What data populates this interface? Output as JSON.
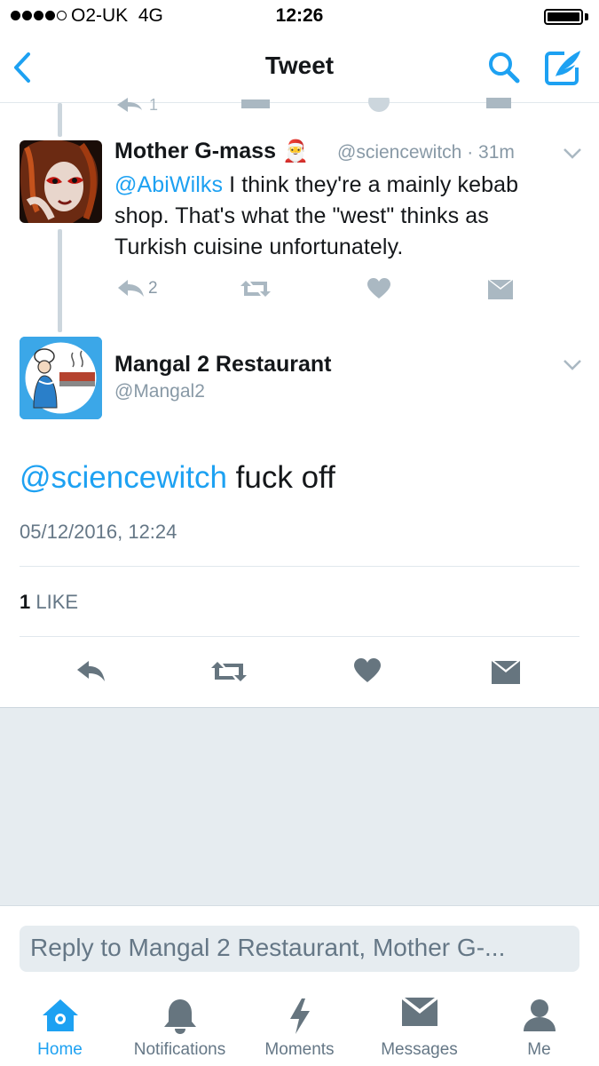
{
  "status_bar": {
    "carrier": "O2-UK",
    "network": "4G",
    "time": "12:26"
  },
  "nav": {
    "title": "Tweet"
  },
  "parent_tweet": {
    "author_name": "Mother G-mass",
    "author_emoji": "🎅",
    "handle": "@sciencewitch",
    "time_ago": "31m",
    "mention": "@AbiWilks",
    "text_line1": " I think they're a mainly kebab",
    "text_line2": "shop. That's what the \"west\" thinks as",
    "text_line3": "Turkish cuisine unfortunately.",
    "reply_count": "2"
  },
  "main_tweet": {
    "author_name": "Mangal 2 Restaurant",
    "handle": "@Mangal2",
    "mention": "@sciencewitch",
    "text": " fuck off",
    "timestamp": "05/12/2016, 12:24",
    "like_count": "1",
    "like_label": "LIKE"
  },
  "reply_box": {
    "placeholder": "Reply to Mangal 2 Restaurant, Mother G-..."
  },
  "tabs": [
    {
      "label": "Home",
      "icon": "home-icon",
      "active": true
    },
    {
      "label": "Notifications",
      "icon": "bell-icon",
      "active": false
    },
    {
      "label": "Moments",
      "icon": "lightning-icon",
      "active": false
    },
    {
      "label": "Messages",
      "icon": "envelope-icon",
      "active": false
    },
    {
      "label": "Me",
      "icon": "person-icon",
      "active": false
    }
  ],
  "colors": {
    "accent": "#1da1f2",
    "icon_gray": "#8899a6",
    "text": "#14171a",
    "background_gray": "#e6ecf0"
  }
}
